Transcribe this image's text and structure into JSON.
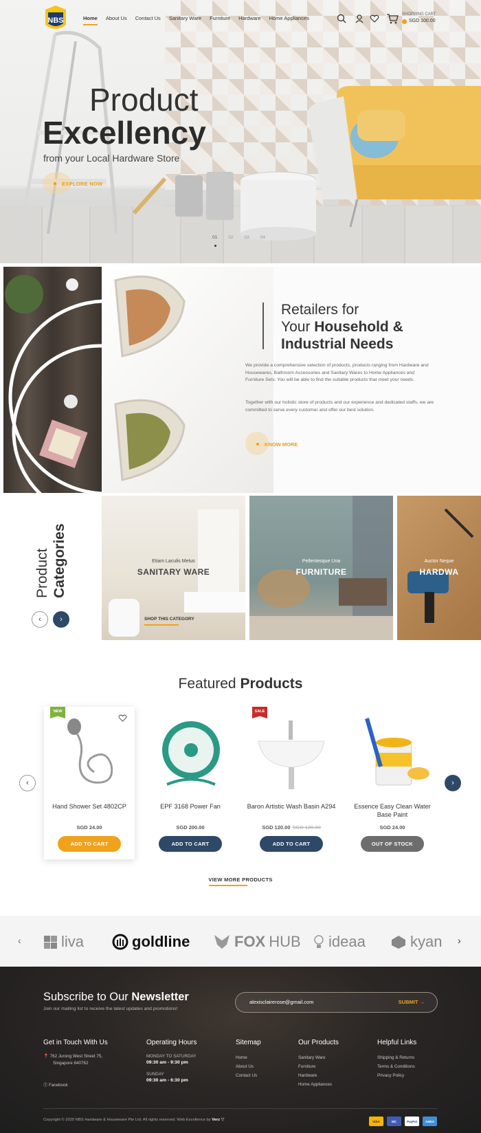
{
  "header": {
    "logo_text": "NBS",
    "nav": [
      "Home",
      "About Us",
      "Contact Us",
      "Sanitary Ware",
      "Furniture",
      "Hardware",
      "Home Appliances"
    ],
    "cart_label": "SHOPPING CART",
    "cart_total": "SGD 100.00"
  },
  "hero": {
    "title_line1": "Product",
    "title_line2": "Excellency",
    "subtitle": "from your Local Hardware Store",
    "cta": "EXPLORE NOW",
    "slides": [
      "01",
      "02",
      "03",
      "04"
    ]
  },
  "about": {
    "heading_light1": "Retailers for",
    "heading_light2": "Your ",
    "heading_bold2": "Household &",
    "heading_bold3": "Industrial Needs",
    "para1": "We provide a comprehensive selection of products, products ranging from Hardware and Housewares, Bathroom Accessories and Sanitary Wares to Home Appliances and Furniture Sets. You will be able to find the suitable products that meet your needs.",
    "para2": "Together with our holistic store of products and our experience and dedicated staffs, we are committed to serve every customer and offer our best solution.",
    "cta": "KNOW MORE"
  },
  "categories": {
    "title_light": "Product",
    "title_bold": "Categories",
    "items": [
      {
        "small": "Etiam Laculis Metus",
        "name": "SANITARY WARE"
      },
      {
        "small": "Pellentesque Una",
        "name": "FURNITURE"
      },
      {
        "small": "Auctor Neque",
        "name": "HARDWA"
      }
    ],
    "shop_label": "SHOP THIS CATEGORY"
  },
  "featured": {
    "title_light": "Featured ",
    "title_bold": "Products",
    "products": [
      {
        "badge": "NEW",
        "name": "Hand Shower Set 4802CP",
        "price": "SGD 24.00",
        "old_price": "",
        "button": "ADD TO CART"
      },
      {
        "badge": "",
        "name": "EPF 3168 Power Fan",
        "price": "SGD 200.00",
        "old_price": "",
        "button": "ADD TO CART"
      },
      {
        "badge": "SALE",
        "name": "Baron Artistic Wash Basin A294",
        "price": "SGD 120.00",
        "old_price": "SGD 120.00",
        "button": "ADD TO CART"
      },
      {
        "badge": "",
        "name": "Essence Easy Clean Water Base Paint",
        "price": "SGD 24.00",
        "old_price": "",
        "button": "OUT OF STOCK"
      }
    ],
    "view_more": "VIEW MORE PRODUCTS"
  },
  "brands": [
    "liva",
    "goldline",
    "FOX",
    "HUB",
    "ideaa",
    "kyan"
  ],
  "footer": {
    "news_title_light": "Subscribe to Our ",
    "news_title_bold": "Newsletter",
    "news_sub": "Join our mailing list to receive the latest updates and promotions!",
    "news_value": "alexisclairerose@gmail.com",
    "news_submit": "SUBMIT",
    "contact_title": "Get in Touch With Us",
    "address1": "762 Jurong West Street 75,",
    "address2": "Singapore 640762",
    "facebook": "Facebook",
    "hours_title": "Operating Hours",
    "weekday_label": "MONDAY TO SATURDAY",
    "weekday_hours": "09:30 am - 9:30 pm",
    "sunday_label": "SUNDAY",
    "sunday_hours": "09:30 am - 6:30 pm",
    "sitemap_title": "Sitemap",
    "sitemap": [
      "Home",
      "About Us",
      "Contact Us"
    ],
    "products_title": "Our Products",
    "products": [
      "Sanitary Ware",
      "Furniture",
      "Hardware",
      "Home Appliances"
    ],
    "help_title": "Helpful Links",
    "help": [
      "Shipping & Returns",
      "Terms & Conditions",
      "Privacy Policy"
    ],
    "copyright": "Copyright © 2020 NBS Hardware & Houseware Pte Ltd. All rights reserved. Web Excellence by ",
    "copyright_brand": "Verz",
    "payments": [
      "VISA",
      "MC",
      "PayPal",
      "AMEX"
    ]
  },
  "colors": {
    "accent": "#f0a020",
    "navy": "#2e4868",
    "footer_bg": "#242222"
  }
}
